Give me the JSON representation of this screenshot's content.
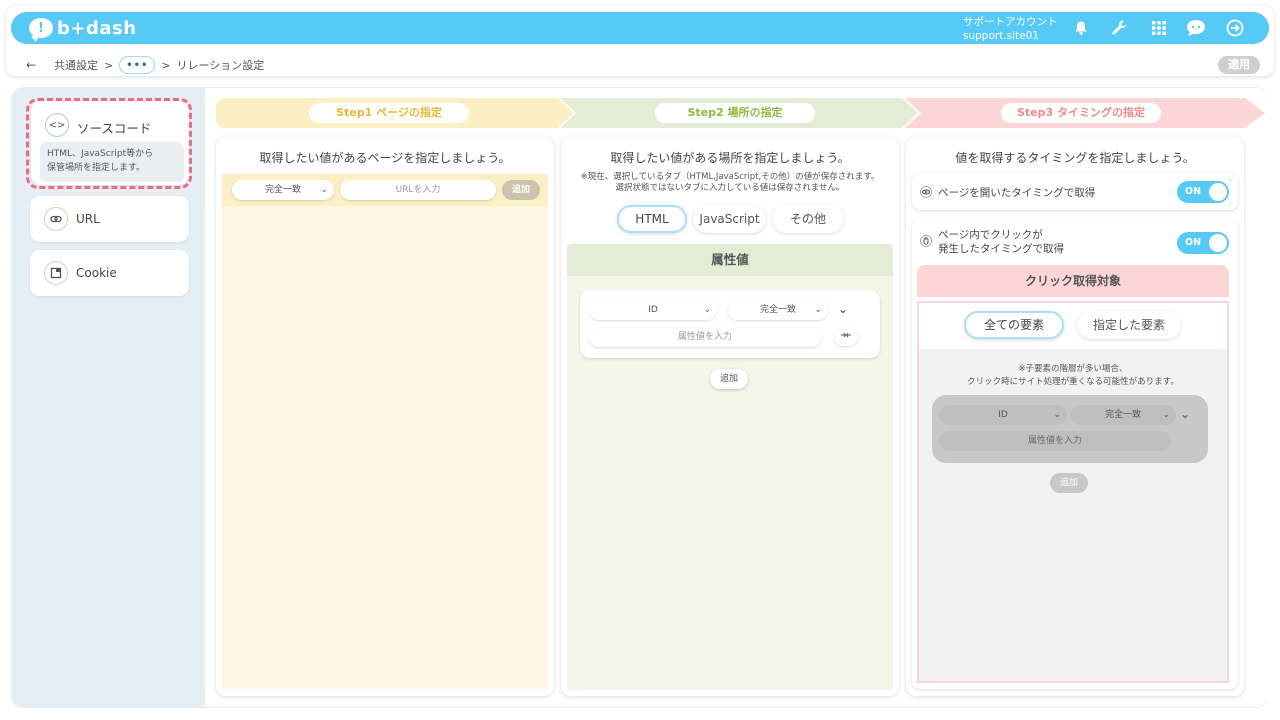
{
  "header": {
    "logo_glyph": "!",
    "logo_text": "b+dash",
    "account_name": "サポートアカウント",
    "account_id": "support.site01",
    "icons": [
      "bell-icon",
      "wrench-icon",
      "grid-icon",
      "chat-icon",
      "logout-icon"
    ]
  },
  "breadcrumb": {
    "back": "←",
    "item1": "共通設定",
    "sep1": ">",
    "ellipsis": "•••",
    "sep2": ">",
    "current": "リレーション設定"
  },
  "apply_label": "適用",
  "sidebar": {
    "source_code": {
      "icon_text": "<>",
      "label": "ソースコード",
      "desc_line1": "HTML、JavaScript等から",
      "desc_line2": "保管場所を指定します。"
    },
    "url": {
      "label": "URL"
    },
    "cookie": {
      "label": "Cookie"
    }
  },
  "steps": {
    "step1": "Step1 ページの指定",
    "step2": "Step2 場所の指定",
    "step3": "Step3 タイミングの指定"
  },
  "panel1": {
    "title": "取得したい値があるページを指定しましょう。",
    "match_select": "完全一致",
    "url_placeholder": "URLを入力",
    "add_label": "追加"
  },
  "panel2": {
    "title": "取得したい値がある場所を指定しましょう。",
    "note_line1": "※現在、選択しているタブ（HTML,JavaScript,その他）の値が保存されます。",
    "note_line2": "選択状態ではないタブに入力している値は保存されません。",
    "tabs": [
      "HTML",
      "JavaScript",
      "その他"
    ],
    "attr_header": "属性値",
    "id_select": "ID",
    "match_select": "完全一致",
    "attr_placeholder": "属性値を入力",
    "add_label": "追加"
  },
  "panel3": {
    "title": "値を取得するタイミングを指定しましょう。",
    "row1_label": "ページを開いたタイミングで取得",
    "row1_toggle": "ON",
    "row2_label_line1": "ページ内でクリックが",
    "row2_label_line2": "発生したタイミングで取得",
    "row2_toggle": "ON",
    "click_target_header": "クリック取得対象",
    "target_tabs": [
      "全ての要素",
      "指定した要素"
    ],
    "note_line1": "※子要素の階層が多い場合、",
    "note_line2": "クリック時にサイト処理が重くなる可能性があります。",
    "id_select": "ID",
    "match_select": "完全一致",
    "attr_placeholder": "属性値を入力",
    "add_label": "追加"
  },
  "colors": {
    "brand": "#56c9f5",
    "step1": "#fcefc4",
    "step2": "#e4ecd5",
    "step3": "#fcd6d6",
    "selected_outline": "#ef6b7f"
  }
}
